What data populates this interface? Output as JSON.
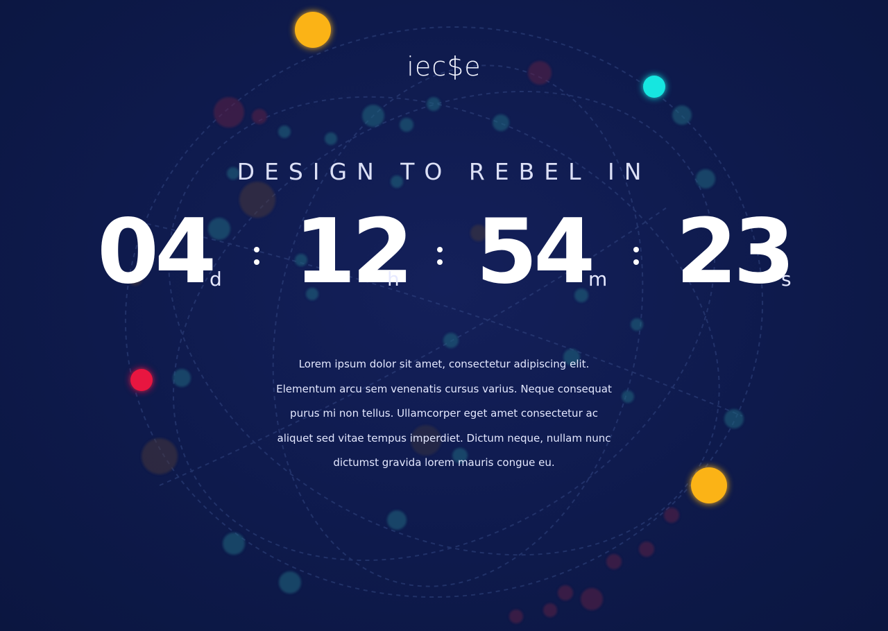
{
  "brand": {
    "logo_text": "iec$e"
  },
  "hero": {
    "headline": "DESIGN TO REBEL IN"
  },
  "countdown": {
    "days": "04",
    "days_suffix": "d",
    "hours": "12",
    "hours_suffix": "h",
    "minutes": "54",
    "minutes_suffix": "m",
    "seconds": "23",
    "seconds_suffix": "s"
  },
  "description": "Lorem ipsum dolor sit amet, consectetur adipiscing elit. Elementum arcu sem venenatis cursus varius. Neque consequat purus mi non tellus. Ullamcorper eget amet consectetur ac aliquet sed vitae tempus imperdiet. Dictum neque, nullam nunc dictumst gravida lorem mauris congue eu.",
  "colors": {
    "background": "#0e1a4c",
    "orbit_yellow": "#fbb316",
    "orbit_cyan": "#17e6e0",
    "orbit_red": "#e8123f",
    "text": "#ffffff"
  }
}
